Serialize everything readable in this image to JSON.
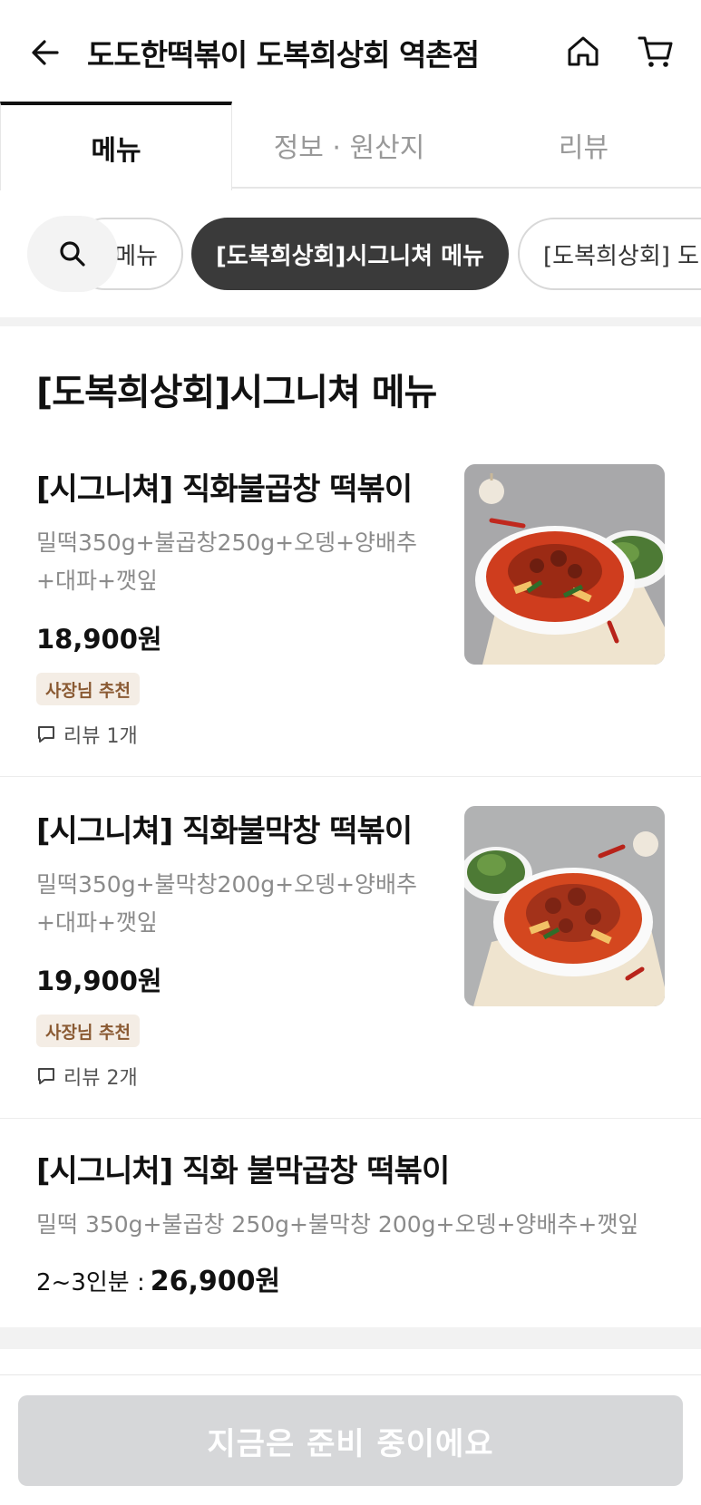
{
  "header": {
    "store_title": "도도한떡볶이 도복희상회 역촌점"
  },
  "tabs": [
    {
      "label": "메뉴",
      "active": true
    },
    {
      "label": "정보 · 원산지",
      "active": false
    },
    {
      "label": "리뷰",
      "active": false
    }
  ],
  "categories": [
    {
      "label": "메뉴",
      "active": false
    },
    {
      "label": "[도복희상회]시그니쳐 메뉴",
      "active": true
    },
    {
      "label": "[도복희상회] 도...",
      "active": false
    }
  ],
  "section": {
    "title": "[도복희상회]시그니쳐 메뉴"
  },
  "items": [
    {
      "name": "[시그니쳐] 직화불곱창 떡볶이",
      "desc": "밀떡350g+불곱창250g+오뎅+양배추+대파+깻잎",
      "price": "18,900원",
      "badge": "사장님 추천",
      "reviews": "리뷰 1개"
    },
    {
      "name": "[시그니쳐] 직화불막창 떡볶이",
      "desc": "밀떡350g+불막창200g+오뎅+양배추+대파+깻잎",
      "price": "19,900원",
      "badge": "사장님 추천",
      "reviews": "리뷰 2개"
    },
    {
      "name": "[시그니처] 직화 불막곱창 떡볶이",
      "desc": "밀떡 350g+불곱창 250g+불막창 200g+오뎅+양배추+깻잎",
      "price_prefix": "2~3인분 :",
      "price": "26,900원"
    }
  ],
  "bottom": {
    "button_label": "지금은 준비 중이에요"
  },
  "colors": {
    "active_chip": "#3a3a3a",
    "badge_bg": "#f4ede5",
    "badge_text": "#8a5a33",
    "disabled_button": "#d6d7d9"
  }
}
